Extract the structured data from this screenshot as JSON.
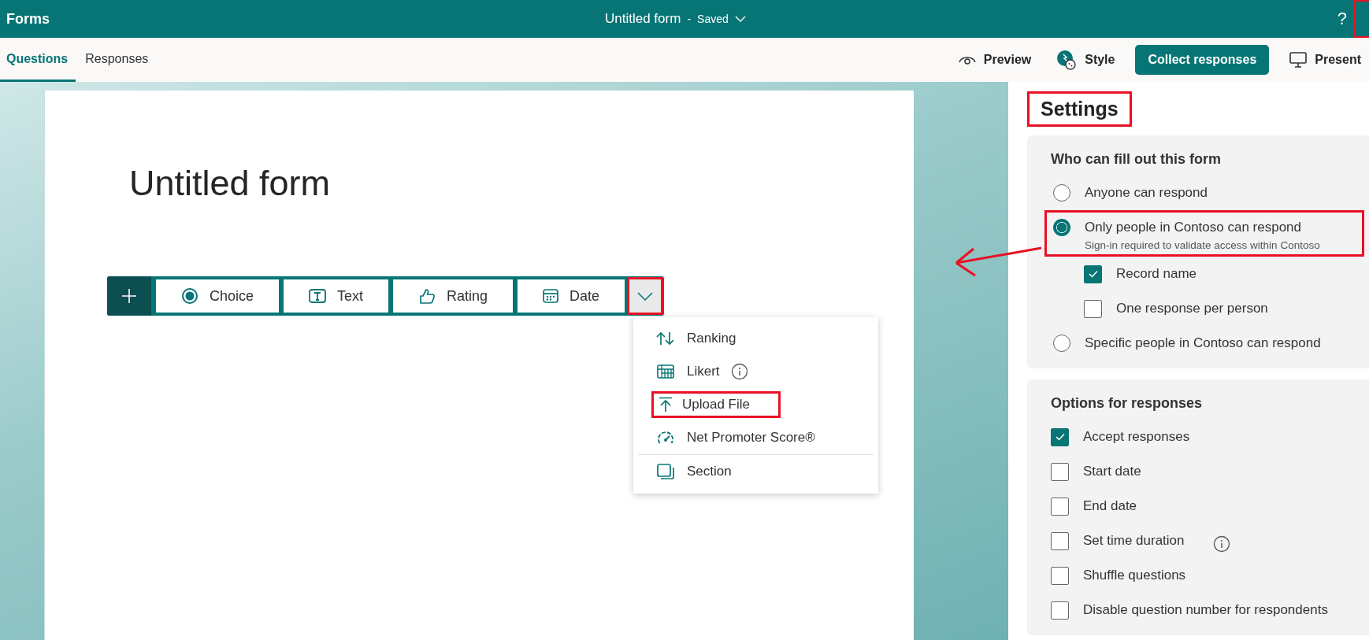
{
  "app": {
    "name": "Forms"
  },
  "header": {
    "title": "Untitled form",
    "separator": "-",
    "status": "Saved",
    "help": "?",
    "corner_highlight": true
  },
  "tabs": [
    {
      "label": "Questions",
      "selected": true
    },
    {
      "label": "Responses",
      "selected": false
    }
  ],
  "actions": [
    {
      "kind": "preview",
      "label": "Preview"
    },
    {
      "kind": "style",
      "label": "Style"
    },
    {
      "kind": "primary",
      "label": "Collect responses"
    },
    {
      "kind": "present",
      "label": "Present"
    }
  ],
  "form": {
    "title": "Untitled form"
  },
  "question_types": [
    {
      "kind": "choice",
      "label": "Choice"
    },
    {
      "kind": "text",
      "label": "Text"
    },
    {
      "kind": "rating",
      "label": "Rating"
    },
    {
      "kind": "date",
      "label": "Date"
    }
  ],
  "more_button": {
    "expanded": true,
    "highlighted": true
  },
  "menu": [
    {
      "kind": "ranking",
      "label": "Ranking",
      "info": false,
      "highlighted": false
    },
    {
      "kind": "likert",
      "label": "Likert",
      "info": true,
      "highlighted": false
    },
    {
      "kind": "upload",
      "label": "Upload File",
      "info": false,
      "highlighted": true
    },
    {
      "kind": "nps",
      "label": "Net Promoter Score®",
      "info": false,
      "highlighted": false
    },
    {
      "kind": "section",
      "label": "Section",
      "info": false,
      "highlighted": false
    }
  ],
  "callout_arrow": true,
  "settings": {
    "title": "Settings",
    "highlighted": true,
    "sections": [
      {
        "heading": "Who can fill out this form",
        "items": [
          {
            "kind": "radio",
            "label": "Anyone can respond",
            "selected": false,
            "highlighted": false
          },
          {
            "kind": "radio",
            "label": "Only people in Contoso can respond",
            "hint": "Sign-in required to validate access within Contoso",
            "selected": true,
            "highlighted": true,
            "children": [
              {
                "kind": "checkbox",
                "label": "Record name",
                "checked": true,
                "info": false
              },
              {
                "kind": "checkbox",
                "label": "One response per person",
                "checked": false,
                "info": false
              }
            ]
          },
          {
            "kind": "radio",
            "label": "Specific people in Contoso can respond",
            "selected": false,
            "highlighted": false
          }
        ]
      },
      {
        "heading": "Options for responses",
        "items": [
          {
            "kind": "checkbox",
            "label": "Accept responses",
            "checked": true,
            "info": false
          },
          {
            "kind": "checkbox",
            "label": "Start date",
            "checked": false,
            "info": false
          },
          {
            "kind": "checkbox",
            "label": "End date",
            "checked": false,
            "info": false
          },
          {
            "kind": "checkbox",
            "label": "Set time duration",
            "checked": false,
            "info": true
          },
          {
            "kind": "checkbox",
            "label": "Shuffle questions",
            "checked": false,
            "info": false
          },
          {
            "kind": "checkbox",
            "label": "Disable question number for respondents",
            "checked": false,
            "info": false
          }
        ]
      }
    ]
  }
}
